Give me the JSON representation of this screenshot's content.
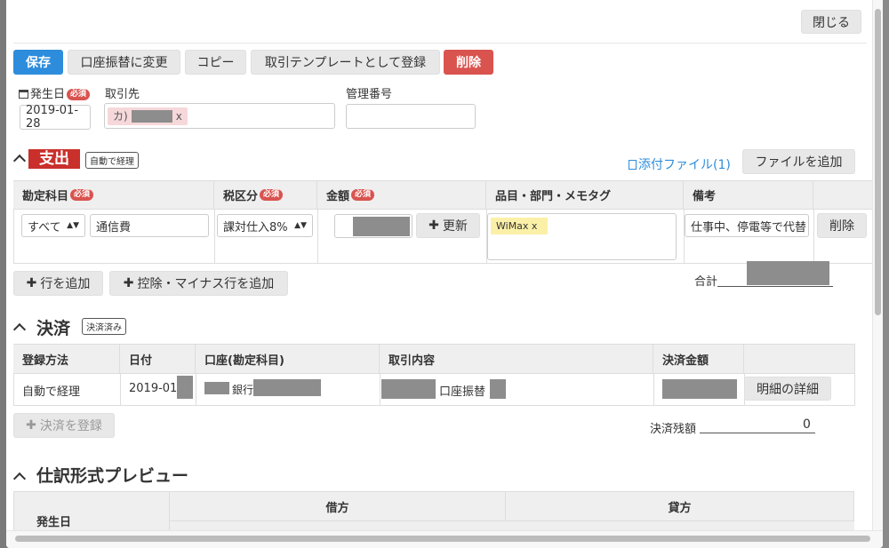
{
  "toolbar": {
    "close_label": "閉じる",
    "save_label": "保存",
    "transfer_label": "口座振替に変更",
    "copy_label": "コピー",
    "template_label": "取引テンプレートとして登録",
    "delete_label": "削除"
  },
  "header": {
    "date_label": "発生日",
    "required_label": "必須",
    "date_value": "2019-01-28",
    "partner_label": "取引先",
    "partner_tag": "カ)",
    "partner_tag_x": "x",
    "manage_label": "管理番号",
    "manage_value": ""
  },
  "expense": {
    "title": "支出",
    "badge": "自動で経理",
    "attach_link": "添付ファイル(1)",
    "add_file": "ファイルを追加",
    "columns": {
      "account": "勘定科目",
      "tax": "税区分",
      "amount": "金額",
      "item": "品目・部門・メモタグ",
      "note": "備考"
    },
    "row": {
      "account_filter": "すべて",
      "account_value": "通信費",
      "tax_value": "課対仕入8%",
      "update_label": "更新",
      "tag_label": "WiMax x",
      "note_value": "仕事中、停電等で代替",
      "delete_label": "削除"
    },
    "add_row": "行を追加",
    "add_deduct_row": "控除・マイナス行を追加",
    "total_label": "合計"
  },
  "settlement": {
    "title": "決済",
    "badge": "決済済み",
    "columns": {
      "method": "登録方法",
      "date": "日付",
      "account": "口座(勘定科目)",
      "content": "取引内容",
      "amount": "決済金額"
    },
    "row": {
      "method": "自動で経理",
      "date": "2019-01-",
      "account_suffix": "銀行",
      "content_middle": "口座振替",
      "detail_label": "明細の詳細"
    },
    "add_label": "決済を登録",
    "balance_label": "決済残額",
    "balance_value": "0"
  },
  "journal": {
    "title": "仕訳形式プレビュー",
    "date_col": "発生日",
    "debit": "借方",
    "credit": "貸方"
  }
}
